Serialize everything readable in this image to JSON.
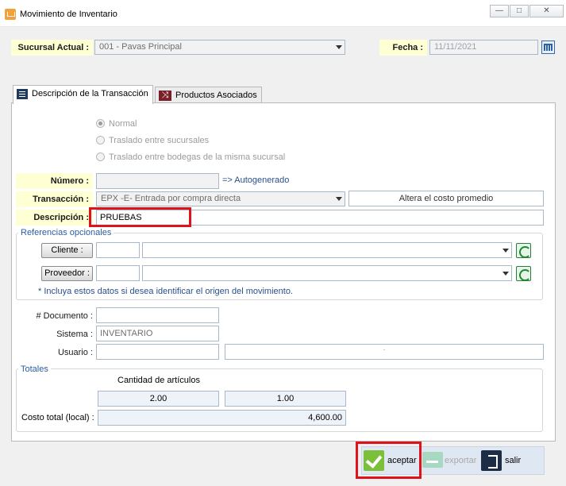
{
  "window": {
    "title": "Movimiento de Inventario",
    "min_glyph": "—",
    "max_glyph": "□",
    "close_glyph": "✕"
  },
  "header": {
    "sucursal_label": "Sucursal Actual :",
    "sucursal_value": "001 - Pavas Principal",
    "fecha_label": "Fecha :",
    "fecha_value": "11/11/2021"
  },
  "tabs": [
    {
      "label": "Descripción de la Transacción",
      "icon": "list-icon",
      "active": true
    },
    {
      "label": "Productos Asociados",
      "icon": "shuffle-icon",
      "active": false
    }
  ],
  "transaction_types": [
    {
      "label": "Normal",
      "selected": true
    },
    {
      "label": "Traslado entre sucursales",
      "selected": false
    },
    {
      "label": "Traslado entre bodegas de la misma sucursal",
      "selected": false
    }
  ],
  "form": {
    "numero_label": "Número :",
    "numero_value": "",
    "autogenerado_text": "=> Autogenerado",
    "transaccion_label": "Transacción :",
    "transaccion_value": "EPX -E- Entrada por compra directa",
    "altera_text": "Altera el costo promedio",
    "descripcion_label": "Descripción :",
    "descripcion_value": "PRUEBAS"
  },
  "referencias": {
    "title": "Referencias opcionales",
    "cliente_button": "Cliente :",
    "cliente_code": "",
    "cliente_name": "",
    "proveedor_button": "Proveedor :",
    "proveedor_code": "",
    "proveedor_name": "",
    "note": "* Incluya estos datos si desea identificar el origen del movimiento."
  },
  "documento": {
    "documento_label": "# Documento :",
    "documento_value": "",
    "sistema_label": "Sistema :",
    "sistema_value": "INVENTARIO",
    "usuario_label": "Usuario :",
    "usuario_value": "",
    "usuario_name": "."
  },
  "totales": {
    "title": "Totales",
    "cantidad_label": "Cantidad de artículos",
    "cantidad_1": "2.00",
    "cantidad_2": "1.00",
    "costo_label": "Costo total (local) :",
    "costo_value": "4,600.00"
  },
  "actions": {
    "aceptar": "aceptar",
    "exportar": "exportar",
    "salir": "salir"
  },
  "colors": {
    "highlight": "#e0121b",
    "label_bg": "#ffffd4",
    "group_title": "#2a5da0"
  }
}
